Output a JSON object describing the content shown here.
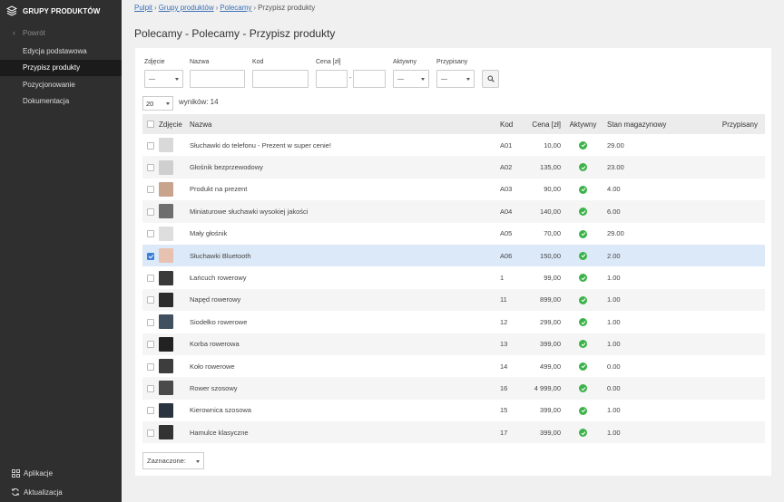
{
  "sidebar": {
    "title": "GRUPY PRODUKTÓW",
    "back_label": "Powrót",
    "items": [
      {
        "label": "Edycja podstawowa",
        "active": false
      },
      {
        "label": "Przypisz produkty",
        "active": true
      },
      {
        "label": "Pozycjonowanie",
        "active": false
      },
      {
        "label": "Dokumentacja",
        "active": false
      }
    ],
    "bottom": [
      {
        "label": "Aplikacje",
        "icon": "grid-icon"
      },
      {
        "label": "Aktualizacja",
        "icon": "refresh-icon"
      }
    ]
  },
  "breadcrumb": {
    "items": [
      "Pulpit",
      "Grupy produktów",
      "Polecamy"
    ],
    "current": "Przypisz produkty",
    "separator": "›"
  },
  "page_title": "Polecamy -  Polecamy - Przypisz produkty",
  "filters": {
    "zdjecie": {
      "label": "Zdjęcie",
      "value": "—"
    },
    "nazwa": {
      "label": "Nazwa",
      "value": ""
    },
    "kod": {
      "label": "Kod",
      "value": ""
    },
    "cena": {
      "label": "Cena [zł]",
      "from": "",
      "to": "",
      "dash": "-"
    },
    "aktywny": {
      "label": "Aktywny",
      "value": "—"
    },
    "przypisany": {
      "label": "Przypisany",
      "value": "—"
    }
  },
  "pagination": {
    "page_size": "20",
    "results_text": "wyników: 14"
  },
  "table": {
    "headers": {
      "zdjecie": "Zdjęcie",
      "nazwa": "Nazwa",
      "kod": "Kod",
      "cena": "Cena [zł]",
      "aktywny": "Aktywny",
      "stan": "Stan magazynowy",
      "przypisany": "Przypisany"
    },
    "rows": [
      {
        "name": "Słuchawki do telefonu - Prezent w super cenie!",
        "kod": "A01",
        "cena": "10,00",
        "stan": "29.00",
        "checked": false,
        "thumb": "#d9d9d9"
      },
      {
        "name": "Głośnik bezprzewodowy",
        "kod": "A02",
        "cena": "135,00",
        "stan": "23.00",
        "checked": false,
        "thumb": "#cfcfcf"
      },
      {
        "name": "Produkt na prezent",
        "kod": "A03",
        "cena": "90,00",
        "stan": "4.00",
        "checked": false,
        "thumb": "#c9a48d"
      },
      {
        "name": "Miniaturowe słuchawki wysokiej jakości",
        "kod": "A04",
        "cena": "140,00",
        "stan": "6.00",
        "checked": false,
        "thumb": "#6e6e6e"
      },
      {
        "name": "Mały głośnik",
        "kod": "A05",
        "cena": "70,00",
        "stan": "29.00",
        "checked": false,
        "thumb": "#dedede"
      },
      {
        "name": "Słuchawki Bluetooth",
        "kod": "A06",
        "cena": "150,00",
        "stan": "2.00",
        "checked": true,
        "thumb": "#e7c2b0"
      },
      {
        "name": "Łańcuch rowerowy",
        "kod": "1",
        "cena": "99,00",
        "stan": "1.00",
        "checked": false,
        "thumb": "#3a3a3a"
      },
      {
        "name": "Napęd rowerowy",
        "kod": "11",
        "cena": "899,00",
        "stan": "1.00",
        "checked": false,
        "thumb": "#2c2c2c"
      },
      {
        "name": "Siodełko rowerowe",
        "kod": "12",
        "cena": "299,00",
        "stan": "1.00",
        "checked": false,
        "thumb": "#41505e"
      },
      {
        "name": "Korba rowerowa",
        "kod": "13",
        "cena": "399,00",
        "stan": "1.00",
        "checked": false,
        "thumb": "#222222"
      },
      {
        "name": "Koło rowerowe",
        "kod": "14",
        "cena": "499,00",
        "stan": "0.00",
        "checked": false,
        "thumb": "#3d3d3d"
      },
      {
        "name": "Rower szosowy",
        "kod": "16",
        "cena": "4 999,00",
        "stan": "0.00",
        "checked": false,
        "thumb": "#4a4a4a"
      },
      {
        "name": "Kierownica szosowa",
        "kod": "15",
        "cena": "399,00",
        "stan": "1.00",
        "checked": false,
        "thumb": "#2a3440"
      },
      {
        "name": "Hamulce klasyczne",
        "kod": "17",
        "cena": "399,00",
        "stan": "1.00",
        "checked": false,
        "thumb": "#333333"
      }
    ]
  },
  "bulk_action": {
    "label": "Zaznaczone:"
  },
  "colors": {
    "sidebar_bg": "#2f2f2f",
    "link": "#3a70b5",
    "active_ok": "#3cb34a",
    "selected_row": "#dce9f8",
    "checkbox_on": "#3b7fd6"
  }
}
